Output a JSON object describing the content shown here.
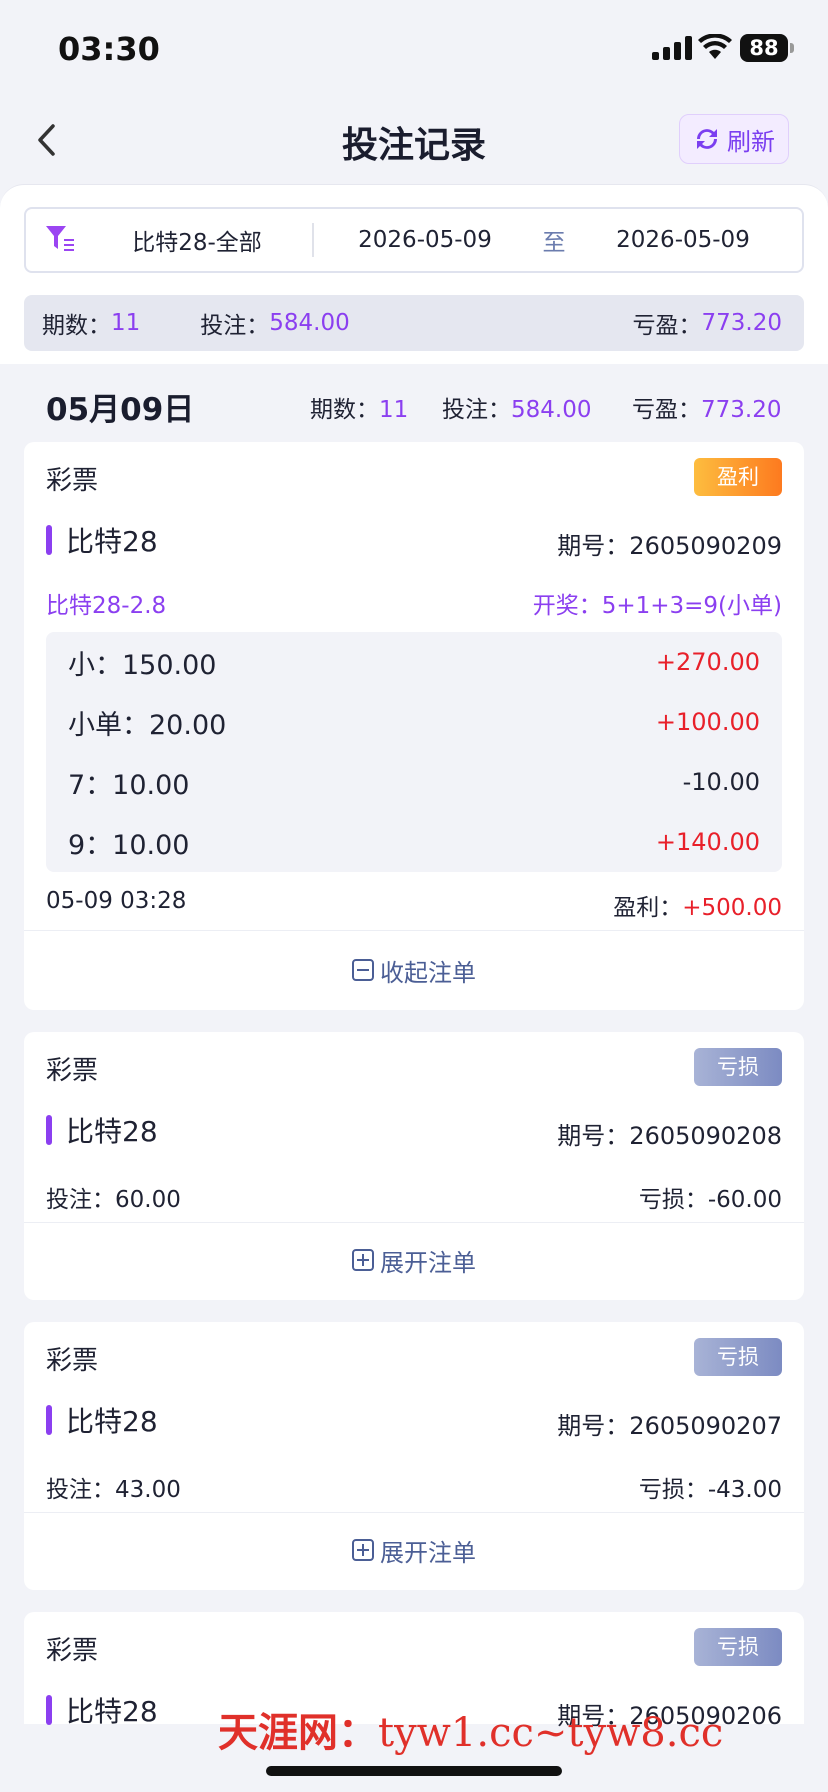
{
  "status_bar": {
    "time": "03:30",
    "battery": "88"
  },
  "header": {
    "title": "投注记录",
    "refresh_label": "刷新"
  },
  "filter": {
    "lottery": "比特28-全部",
    "start_date": "2026-05-09",
    "to_label": "至",
    "end_date": "2026-05-09"
  },
  "summary": {
    "periods_label": "期数：",
    "periods": "11",
    "bet_label": "投注：",
    "bet": "584.00",
    "pnl_label": "亏盈：",
    "pnl": "773.20"
  },
  "date_group": {
    "date": "05月09日",
    "periods_label": "期数：",
    "periods": "11",
    "bet_label": "投注：",
    "bet": "584.00",
    "pnl_label": "亏盈：",
    "pnl": "773.20"
  },
  "colors": {
    "accent": "#8b3ff0",
    "win_red": "#e8202a",
    "link": "#4b5e95"
  },
  "cards": [
    {
      "category": "彩票",
      "badge": "盈利",
      "game": "比特28",
      "issue": "期号：2605090209",
      "play": "比特28-2.8",
      "draw": "开奖：5+1+3=9(小单)",
      "bets": [
        {
          "key": "小：150.00",
          "value": "+270.00"
        },
        {
          "key": "小单：20.00",
          "value": "+100.00"
        },
        {
          "key": "7：10.00",
          "value": "-10.00"
        },
        {
          "key": "9：10.00",
          "value": "+140.00"
        }
      ],
      "time": "05-09 03:28",
      "profit_label": "盈利：",
      "profit": "+500.00",
      "toggle": "收起注单"
    },
    {
      "category": "彩票",
      "badge": "亏损",
      "game": "比特28",
      "issue": "期号：2605090208",
      "bet_text": "投注：60.00",
      "loss_text": "亏损：-60.00",
      "toggle": "展开注单"
    },
    {
      "category": "彩票",
      "badge": "亏损",
      "game": "比特28",
      "issue": "期号：2605090207",
      "bet_text": "投注：43.00",
      "loss_text": "亏损：-43.00",
      "toggle": "展开注单"
    },
    {
      "category": "彩票",
      "badge": "亏损",
      "game": "比特28",
      "issue": "期号：2605090206"
    }
  ],
  "watermark": {
    "site": "天涯网：",
    "url": "tyw1.cc~tyw8.cc"
  }
}
